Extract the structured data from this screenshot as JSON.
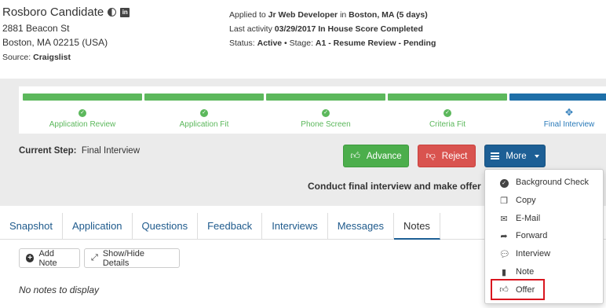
{
  "candidate": {
    "name": "Rosboro Candidate",
    "address_line1": "2881 Beacon St",
    "address_line2": "Boston, MA 02215 (USA)",
    "source_label": "Source:",
    "source_value": "Craigslist"
  },
  "application": {
    "applied_prefix": "Applied to",
    "job_title": "Jr Web Developer",
    "in_word": "in",
    "location_days": "Boston, MA (5 days)",
    "activity_prefix": "Last activity",
    "activity_value": "03/29/2017 In House Score Completed",
    "status_prefix": "Status:",
    "status_value": "Active",
    "stage_sep": "• Stage:",
    "stage_value": "A1 - Resume Review - Pending"
  },
  "steps": [
    {
      "label": "Application Review",
      "state": "done"
    },
    {
      "label": "Application Fit",
      "state": "done"
    },
    {
      "label": "Phone Screen",
      "state": "done"
    },
    {
      "label": "Criteria Fit",
      "state": "done"
    },
    {
      "label": "Final Interview",
      "state": "current"
    }
  ],
  "current_step": {
    "label": "Current Step:",
    "value": "Final Interview"
  },
  "actions": {
    "advance": "Advance",
    "reject": "Reject",
    "more": "More"
  },
  "instruction": "Conduct final interview and make offer",
  "more_menu": [
    {
      "label": "Background Check",
      "icon": "check-circle-icon"
    },
    {
      "label": "Copy",
      "icon": "copy-icon"
    },
    {
      "label": "E-Mail",
      "icon": "envelope-icon"
    },
    {
      "label": "Forward",
      "icon": "share-arrow-icon"
    },
    {
      "label": "Interview",
      "icon": "chat-bubbles-icon"
    },
    {
      "label": "Note",
      "icon": "note-icon"
    },
    {
      "label": "Offer",
      "icon": "thumbs-up-icon",
      "highlighted": true
    }
  ],
  "tabs": [
    "Snapshot",
    "Application",
    "Questions",
    "Feedback",
    "Interviews",
    "Messages",
    "Notes"
  ],
  "active_tab": "Notes",
  "notes": {
    "add_note": "Add Note",
    "toggle_details": "Show/Hide Details",
    "empty_message": "No notes to display"
  },
  "colors": {
    "step_done": "#5cb85c",
    "step_current": "#1e6fa8",
    "advance": "#4cae4c",
    "reject": "#d9534f",
    "more": "#1d5f95",
    "highlight_border": "#d9161f"
  }
}
